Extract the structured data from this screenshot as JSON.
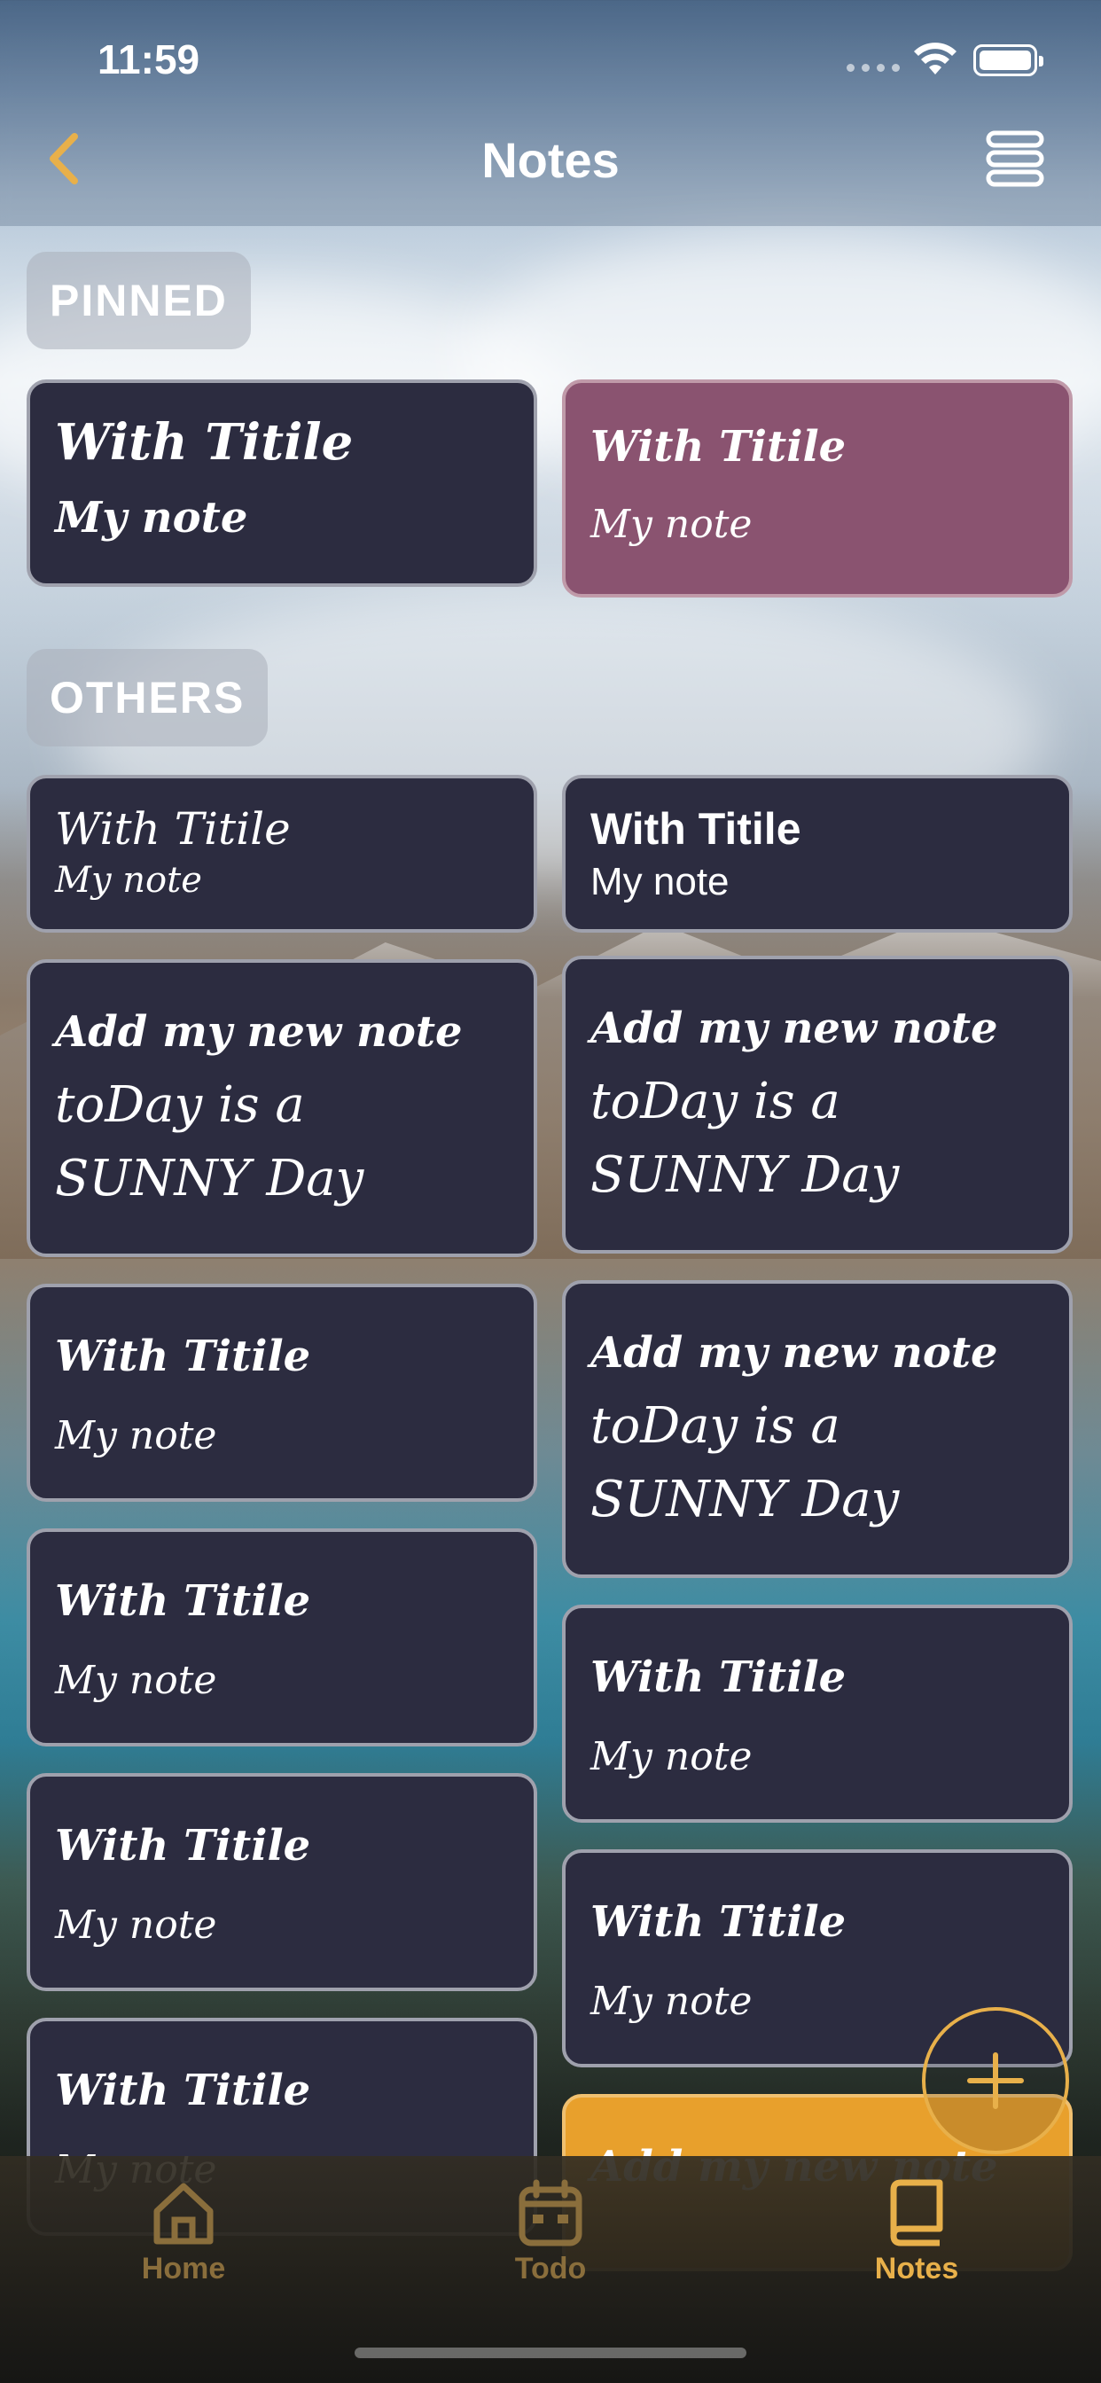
{
  "status_bar": {
    "time": "11:59"
  },
  "nav": {
    "title": "Notes"
  },
  "sections": {
    "pinned": "PINNED",
    "others": "OTHERS"
  },
  "pinned_notes": [
    {
      "title": "With Titile",
      "body": "My note"
    },
    {
      "title": "With Titile",
      "body": "My note"
    }
  ],
  "other_notes": [
    {
      "title": "With Titile",
      "body": "My note"
    },
    {
      "title": "With Titile",
      "body": "My note"
    },
    {
      "title": "Add my new note",
      "body_line1": "toDay is a",
      "body_line2": "SUNNY Day"
    },
    {
      "title": "Add my new note",
      "body_line1": "toDay is a",
      "body_line2": "SUNNY Day"
    },
    {
      "title": "With Titile",
      "body": "My note"
    },
    {
      "title": "Add my new note",
      "body_line1": "toDay is a",
      "body_line2": "SUNNY Day"
    },
    {
      "title": "With Titile",
      "body": "My note"
    },
    {
      "title": "With Titile",
      "body": "My note"
    },
    {
      "title": "With Titile",
      "body": "My note"
    },
    {
      "title": "With Titile",
      "body": "My note"
    },
    {
      "title": "With Titile",
      "body": "My note"
    },
    {
      "title": "Add my new note"
    }
  ],
  "tabs": [
    {
      "label": "Home",
      "icon": "home-icon"
    },
    {
      "label": "Todo",
      "icon": "calendar-icon"
    },
    {
      "label": "Notes",
      "icon": "book-icon",
      "active": true
    }
  ],
  "colors": {
    "accent": "#e8b04a",
    "inactive_tab": "#8a6e3c",
    "card": "#2c2c40",
    "card_pink": "#8a5370",
    "card_orange": "#e8a02c"
  }
}
